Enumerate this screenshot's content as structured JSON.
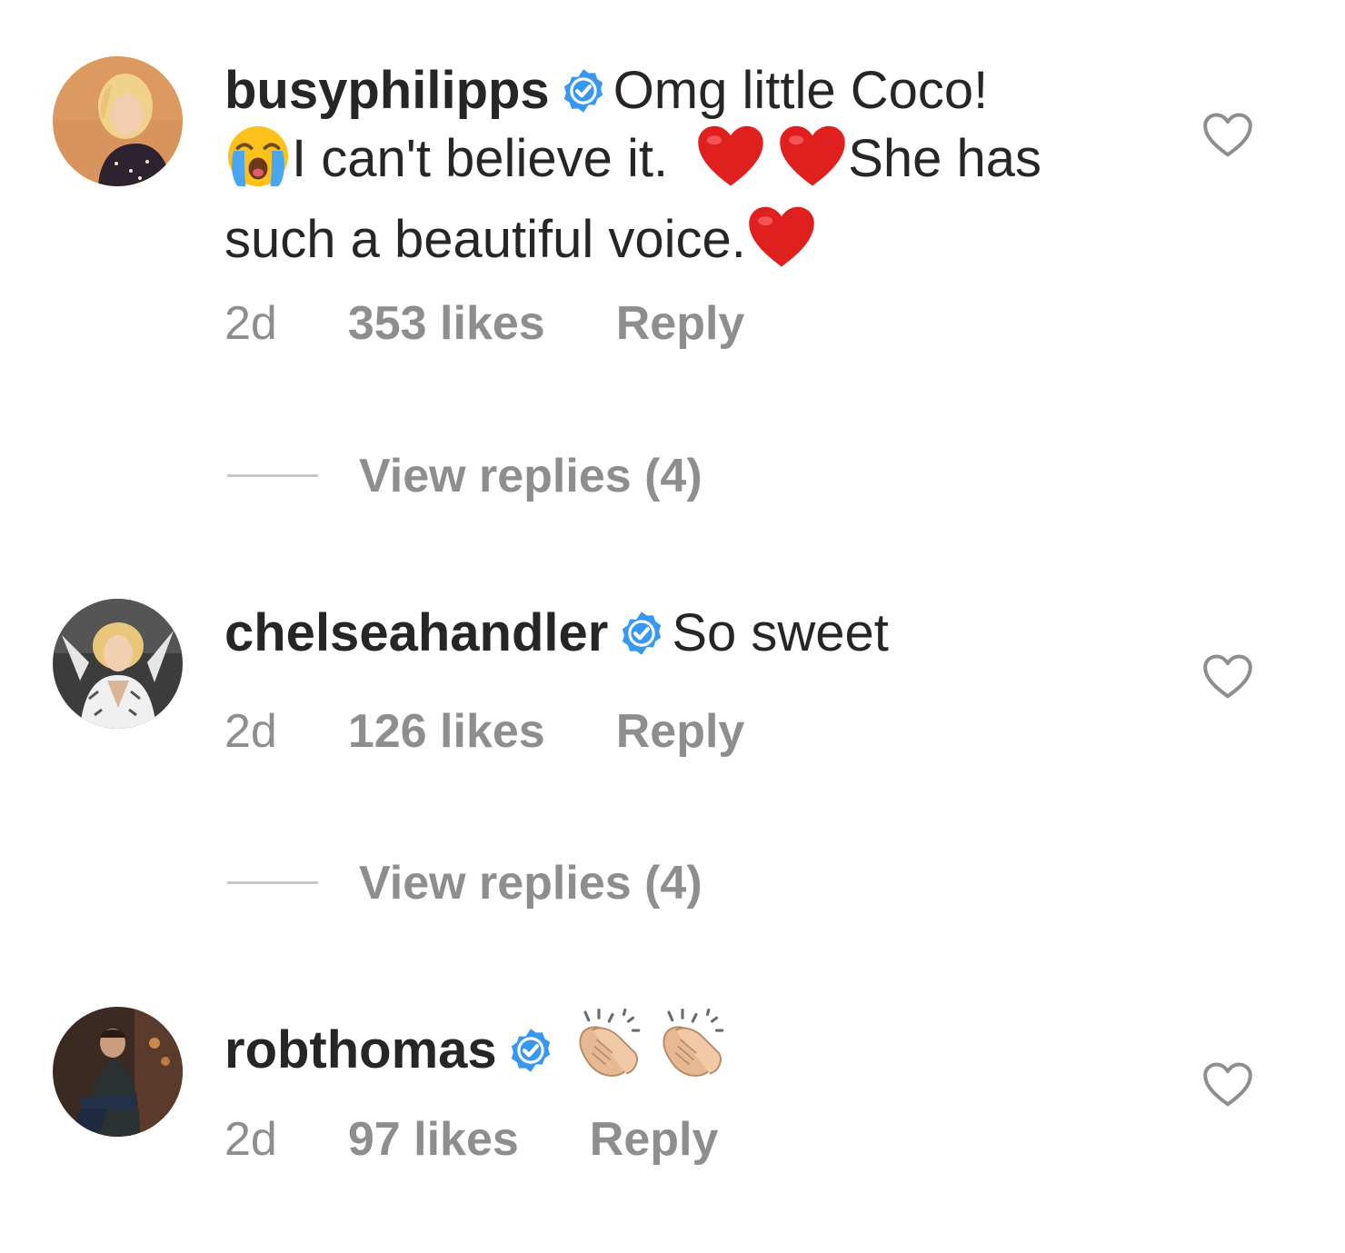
{
  "comments": [
    {
      "username": "busyphilipps",
      "text_parts": [
        "Omg little Coco!",
        "I can't believe it.",
        "She has such a beautiful voice."
      ],
      "emojis": [
        "loudly-crying-face",
        "red-heart",
        "red-heart",
        "red-heart"
      ],
      "time": "2d",
      "likes": "353 likes",
      "reply": "Reply",
      "view_replies": "View replies (4)"
    },
    {
      "username": "chelseahandler",
      "text": "So sweet",
      "time": "2d",
      "likes": "126 likes",
      "reply": "Reply",
      "view_replies": "View replies (4)"
    },
    {
      "username": "robthomas",
      "emojis": [
        "clapping-hands-medium-light-skin",
        "clapping-hands-medium-light-skin"
      ],
      "time": "2d",
      "likes": "97 likes",
      "reply": "Reply"
    }
  ],
  "colors": {
    "text": "#262626",
    "meta": "#8e8e8e",
    "verified": "#3897f0",
    "heart_outline": "#8e8e8e",
    "divider": "#c7c7c7"
  }
}
